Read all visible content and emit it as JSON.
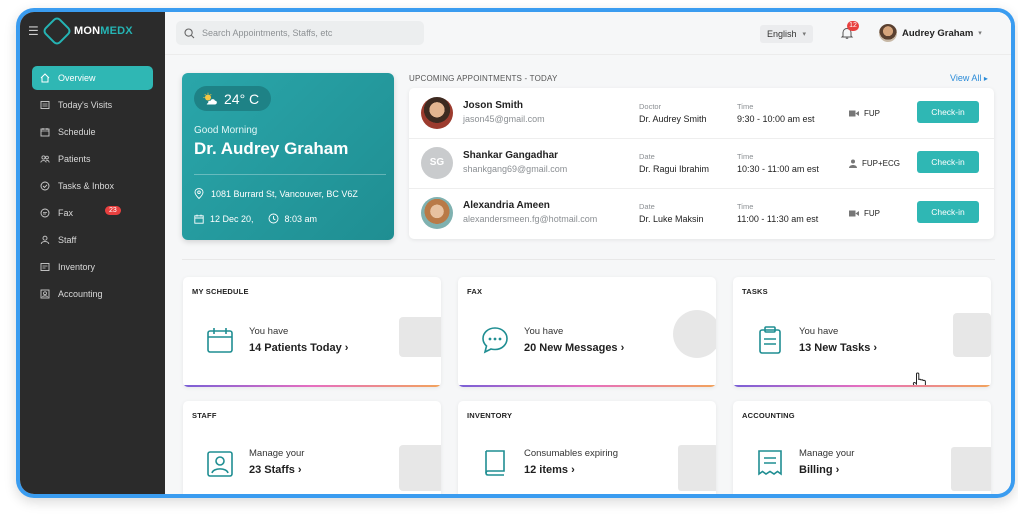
{
  "brand": {
    "name_a": "MON",
    "name_b": "MEDX"
  },
  "sidebar": {
    "items": [
      {
        "label": "Overview",
        "icon": "home-icon",
        "active": true
      },
      {
        "label": "Today's Visits",
        "icon": "visits-icon"
      },
      {
        "label": "Schedule",
        "icon": "calendar-icon"
      },
      {
        "label": "Patients",
        "icon": "patients-icon"
      },
      {
        "label": "Tasks & Inbox",
        "icon": "tasks-icon"
      },
      {
        "label": "Fax",
        "icon": "fax-icon",
        "badge": "23"
      },
      {
        "label": "Staff",
        "icon": "staff-icon"
      },
      {
        "label": "Inventory",
        "icon": "inventory-icon"
      },
      {
        "label": "Accounting",
        "icon": "accounting-icon"
      }
    ]
  },
  "topbar": {
    "search_placeholder": "Search Appointments, Staffs, etc",
    "language": "English",
    "notifications": "12",
    "user_name": "Audrey Graham"
  },
  "welcome": {
    "temperature": "24° C",
    "greeting": "Good Morning",
    "doctor": "Dr. Audrey Graham",
    "address": "1081 Burrard St, Vancouver, BC V6Z",
    "date": "12 Dec 20,",
    "time": "8:03 am"
  },
  "appointments": {
    "heading": "UPCOMING APPOINTMENTS - TODAY",
    "view_all": "View All",
    "rows": [
      {
        "name": "Joson Smith",
        "email": "jason45@gmail.com",
        "doc_label": "Doctor",
        "doctor": "Dr. Audrey Smith",
        "time_label": "Time",
        "time": "9:30 - 10:00 am est",
        "type": "FUP",
        "action": "Check-in"
      },
      {
        "name": "Shankar Gangadhar",
        "initials": "SG",
        "email": "shankgang69@gmail.com",
        "doc_label": "Date",
        "doctor": "Dr. Ragui Ibrahim",
        "time_label": "Time",
        "time": "10:30 - 11:00 am est",
        "type": "FUP+ECG",
        "action": "Check-in"
      },
      {
        "name": "Alexandria Ameen",
        "email": "alexandersmeen.fg@hotmail.com",
        "doc_label": "Date",
        "doctor": "Dr. Luke Maksin",
        "time_label": "Time",
        "time": "11:00 - 11:30 am est",
        "type": "FUP",
        "action": "Check-in"
      }
    ]
  },
  "cards": [
    {
      "title": "MY SCHEDULE",
      "sub": "You have",
      "main": "14 Patients Today",
      "arrow": "›"
    },
    {
      "title": "FAX",
      "sub": "You have",
      "main": "20 New Messages",
      "arrow": "›"
    },
    {
      "title": "TASKS",
      "sub": "You have",
      "main": "13 New Tasks",
      "arrow": "›"
    },
    {
      "title": "STAFF",
      "sub": "Manage your",
      "main": "23 Staffs",
      "arrow": "›"
    },
    {
      "title": "INVENTORY",
      "sub": "Consumables expiring",
      "main": "12 items",
      "arrow": "›"
    },
    {
      "title": "ACCOUNTING",
      "sub": "Manage your",
      "main": "Billing",
      "arrow": "›"
    }
  ],
  "colors": {
    "accent": "#2fb7b4",
    "sidebar": "#2b2b2b",
    "badge": "#e8403f",
    "link": "#2a8bd8"
  }
}
